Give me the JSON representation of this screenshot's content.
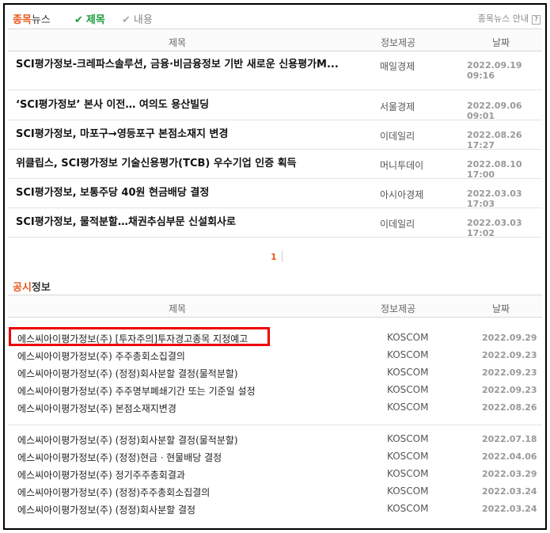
{
  "header": {
    "section_accent": "종목",
    "section_rest": "뉴스",
    "tab_title": "제목",
    "tab_content": "내용",
    "check_glyph": "✔",
    "guide": "종목뉴스 안내",
    "help": "?"
  },
  "news": {
    "columns": {
      "title": "제목",
      "source": "정보제공",
      "date": "날짜"
    },
    "rows": [
      {
        "title": "SCI평가정보-크레파스솔루션, 금융·비금융정보 기반 새로운 신용평가M...",
        "source": "매일경제",
        "date": "2022.09.19 09:16"
      },
      {
        "title": "‘SCI평가정보’ 본사 이전… 여의도 용산빌딩",
        "source": "서울경제",
        "date": "2022.09.06 09:01"
      },
      {
        "title": "SCI평가정보, 마포구→영등포구 본점소재지 변경",
        "source": "이데일리",
        "date": "2022.08.26 17:27"
      },
      {
        "title": "위클립스, SCI평가정보 기술신용평가(TCB) 우수기업 인증 획득",
        "source": "머니투데이",
        "date": "2022.08.10 17:00"
      },
      {
        "title": "SCI평가정보, 보통주당 40원 현금배당 결정",
        "source": "아시아경제",
        "date": "2022.03.03 17:03"
      },
      {
        "title": "SCI평가정보, 물적분할…채권추심부문 신설회사로",
        "source": "이데일리",
        "date": "2022.03.03 17:02"
      }
    ],
    "page": "1"
  },
  "disclosure": {
    "section_accent": "공시",
    "section_rest": "정보",
    "columns": {
      "title": "제목",
      "source": "정보제공",
      "date": "날짜"
    },
    "rows": [
      {
        "title": "에스씨아이평가정보(주) [투자주의]투자경고종목 지정예고",
        "source": "KOSCOM",
        "date": "2022.09.29"
      },
      {
        "title": "에스씨아이평가정보(주) 주주총회소집결의",
        "source": "KOSCOM",
        "date": "2022.09.23"
      },
      {
        "title": "에스씨아이평가정보(주) (정정)회사분할 결정(물적분할)",
        "source": "KOSCOM",
        "date": "2022.09.23"
      },
      {
        "title": "에스씨아이평가정보(주) 주주명부폐쇄기간 또는 기준일 설정",
        "source": "KOSCOM",
        "date": "2022.09.23"
      },
      {
        "title": "에스씨아이평가정보(주) 본점소재지변경",
        "source": "KOSCOM",
        "date": "2022.08.26"
      },
      {
        "title": "에스씨아이평가정보(주) (정정)회사분할 결정(물적분할)",
        "source": "KOSCOM",
        "date": "2022.07.18"
      },
      {
        "title": "에스씨아이평가정보(주) (정정)현금ㆍ현물배당 결정",
        "source": "KOSCOM",
        "date": "2022.04.06"
      },
      {
        "title": "에스씨아이평가정보(주) 정기주주총회결과",
        "source": "KOSCOM",
        "date": "2022.03.29"
      },
      {
        "title": "에스씨아이평가정보(주) (정정)주주총회소집결의",
        "source": "KOSCOM",
        "date": "2022.03.24"
      },
      {
        "title": "에스씨아이평가정보(주) (정정)회사분할 결정",
        "source": "KOSCOM",
        "date": "2022.03.24"
      }
    ]
  },
  "colors": {
    "accent": "#e8581a",
    "green": "#1a9c3c",
    "highlight": "#e00000"
  }
}
